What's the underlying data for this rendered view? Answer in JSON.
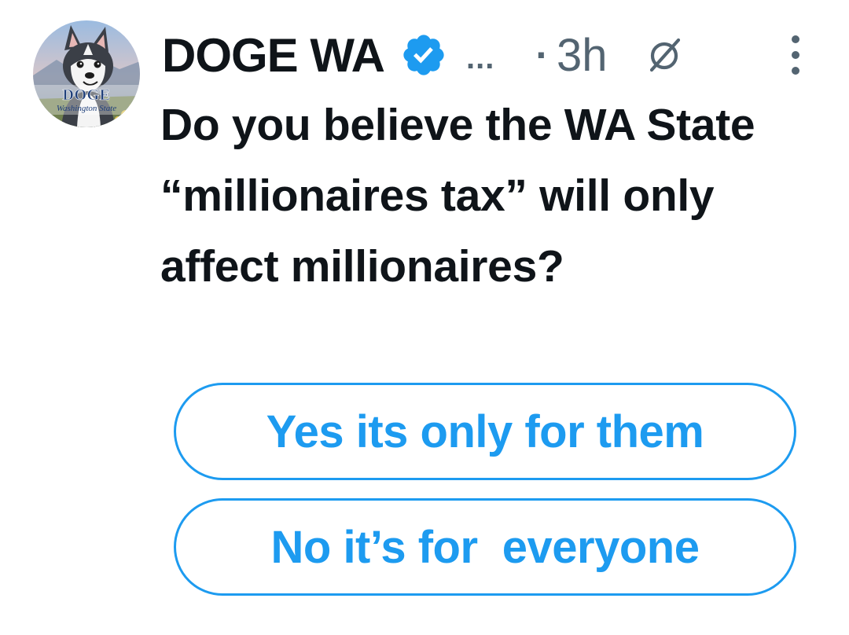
{
  "avatar": {
    "icon": "husky-avatar-icon",
    "title": "DOGE",
    "subtitle": "Washington State"
  },
  "header": {
    "name": "DOGE WA",
    "verified_icon": "verified-badge-icon",
    "inline_more": "...",
    "separator": "·",
    "time": "3h",
    "grok_icon": "grok-icon",
    "more_icon": "more-vertical-icon"
  },
  "tweet": {
    "text": "Do you believe the WA State “millionaires tax” will only affect millionaires?"
  },
  "poll": {
    "options": [
      {
        "label": "Yes its only for them"
      },
      {
        "label": "No it’s for  everyone"
      }
    ]
  },
  "colors": {
    "accent": "#1d9bf0",
    "text": "#0f1419",
    "muted": "#536471"
  }
}
